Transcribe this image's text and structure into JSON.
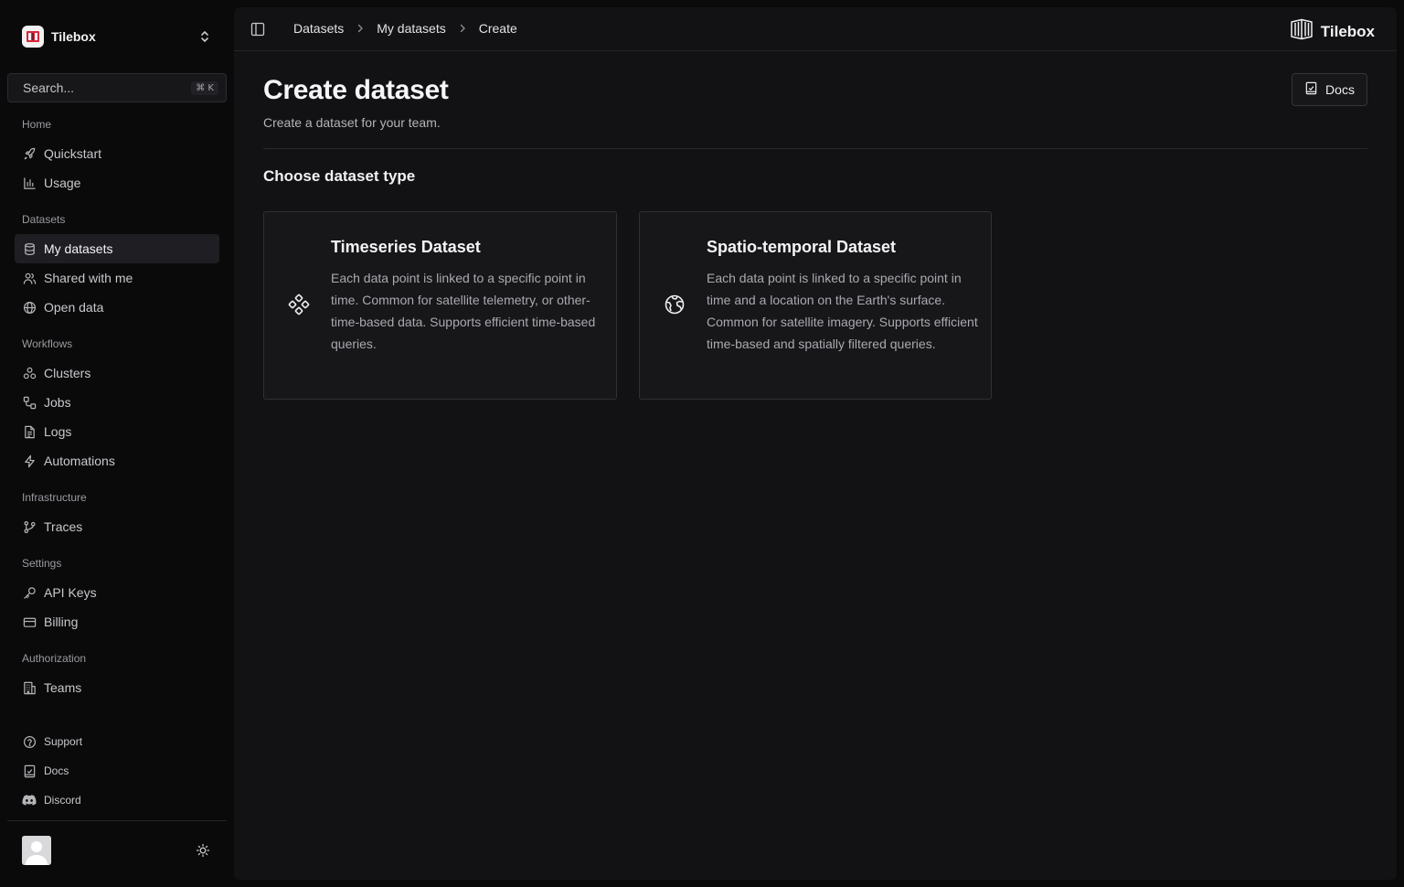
{
  "team": {
    "name": "Tilebox"
  },
  "search": {
    "placeholder": "Search...",
    "shortcut": "⌘ K"
  },
  "sidebar": {
    "sections": [
      {
        "label": "Home"
      },
      {
        "label": "Datasets"
      },
      {
        "label": "Workflows"
      },
      {
        "label": "Infrastructure"
      },
      {
        "label": "Settings"
      },
      {
        "label": "Authorization"
      }
    ],
    "items": {
      "quickstart": "Quickstart",
      "usage": "Usage",
      "my_datasets": "My datasets",
      "shared_with_me": "Shared with me",
      "open_data": "Open data",
      "clusters": "Clusters",
      "jobs": "Jobs",
      "logs": "Logs",
      "automations": "Automations",
      "traces": "Traces",
      "api_keys": "API Keys",
      "billing": "Billing",
      "teams": "Teams"
    },
    "footer": {
      "support": "Support",
      "docs": "Docs",
      "discord": "Discord"
    },
    "active_item": "my_datasets"
  },
  "breadcrumb": [
    "Datasets",
    "My datasets",
    "Create"
  ],
  "brand": {
    "name": "Tilebox"
  },
  "page": {
    "title": "Create dataset",
    "subtitle": "Create a dataset for your team.",
    "docs_button": "Docs",
    "section_title": "Choose dataset type"
  },
  "cards": [
    {
      "icon": "timeseries-icon",
      "title": "Timeseries Dataset",
      "description": "Each data point is linked to a specific point in time. Common for satellite telemetry, or other-time-based data. Supports efficient time-based queries."
    },
    {
      "icon": "globe-icon",
      "title": "Spatio-temporal Dataset",
      "description": "Each data point is linked to a specific point in time and a location on the Earth's surface. Common for satellite imagery. Supports efficient time-based and spatially filtered queries."
    }
  ]
}
